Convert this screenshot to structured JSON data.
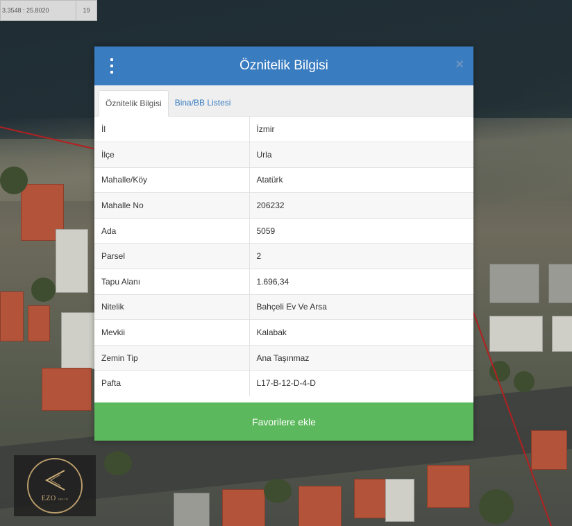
{
  "map": {
    "coordinates": "3.3548 : 25.8020",
    "scale": "19"
  },
  "logo": {
    "brand": "EZO",
    "sub": "GELİN"
  },
  "modal": {
    "title": "Öznitelik Bilgisi",
    "menu_icon": "vertical-dots-icon",
    "close_icon": "close-icon",
    "close_symbol": "×",
    "tabs": [
      {
        "label": "Öznitelik Bilgisi",
        "active": true
      },
      {
        "label": "Bina/BB Listesi",
        "active": false
      }
    ],
    "rows": [
      {
        "key": "İl",
        "value": "İzmir"
      },
      {
        "key": "İlçe",
        "value": "Urla"
      },
      {
        "key": "Mahalle/Köy",
        "value": "Atatürk"
      },
      {
        "key": "Mahalle No",
        "value": "206232"
      },
      {
        "key": "Ada",
        "value": "5059"
      },
      {
        "key": "Parsel",
        "value": "2"
      },
      {
        "key": "Tapu Alanı",
        "value": "1.696,34"
      },
      {
        "key": "Nitelik",
        "value": "Bahçeli Ev Ve Arsa"
      },
      {
        "key": "Mevkii",
        "value": "Kalabak"
      },
      {
        "key": "Zemin Tip",
        "value": "Ana Taşınmaz"
      },
      {
        "key": "Pafta",
        "value": "L17-B-12-D-4-D"
      }
    ],
    "favorite_button": "Favorilere ekle"
  },
  "colors": {
    "header": "#3a7cc0",
    "button": "#5cb85c",
    "parcel_line": "#b32020"
  }
}
